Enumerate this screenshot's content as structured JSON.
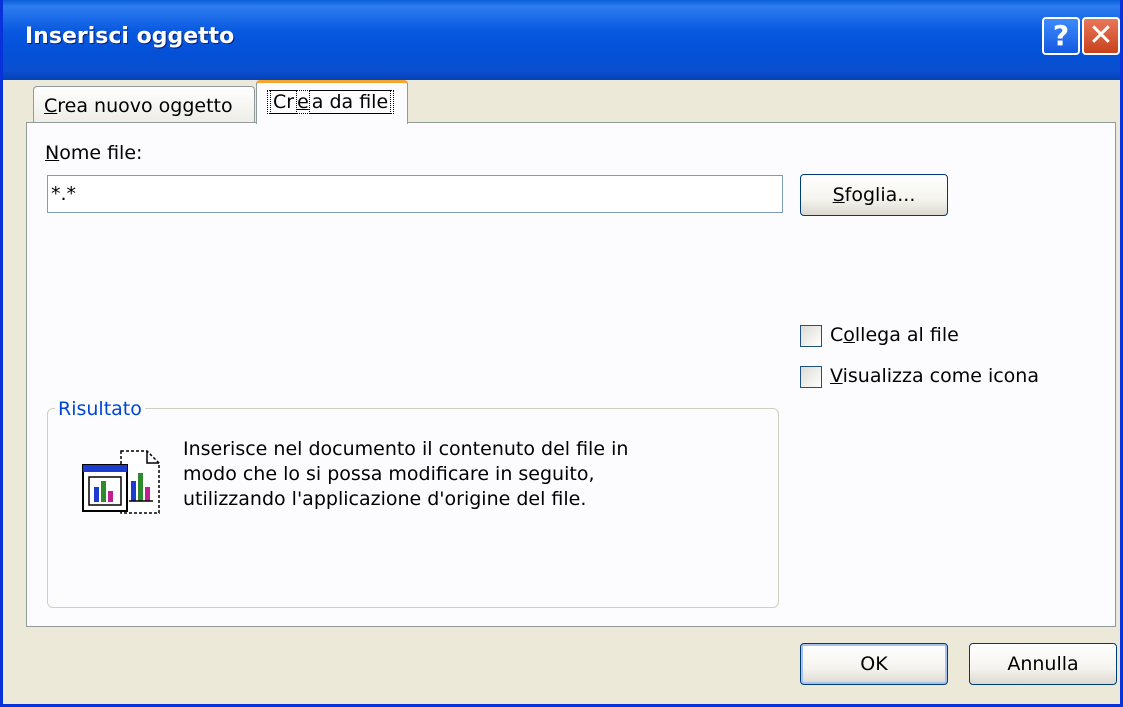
{
  "window": {
    "title": "Inserisci oggetto",
    "help_label": "?",
    "close_label": "✕"
  },
  "tabs": {
    "new_object": {
      "pre": "",
      "key": "C",
      "post": "rea nuovo oggetto"
    },
    "from_file": {
      "pre": "Cr",
      "key": "e",
      "post": "a da file"
    }
  },
  "file_section": {
    "label": {
      "key": "N",
      "post": "ome file:"
    },
    "value": "*.*",
    "browse": {
      "key": "S",
      "post": "foglia..."
    }
  },
  "options": {
    "link": {
      "pre": "C",
      "key": "o",
      "post": "llega al file",
      "checked": false
    },
    "display_icon": {
      "pre": "",
      "key": "V",
      "post": "isualizza come icona",
      "checked": false
    }
  },
  "result": {
    "title": "Risultato",
    "lines": [
      "Inserisce nel documento il contenuto del file in",
      "modo che lo si possa modificare in seguito,",
      "utilizzando l'applicazione d'origine del file."
    ],
    "icon": "embed-file-icon"
  },
  "buttons": {
    "ok": "OK",
    "cancel": "Annulla"
  },
  "colors": {
    "titlebar": "#0450d6",
    "window_bg": "#ece9d8",
    "group_title": "#0046d5",
    "active_tab_accent": "#f7a531"
  }
}
